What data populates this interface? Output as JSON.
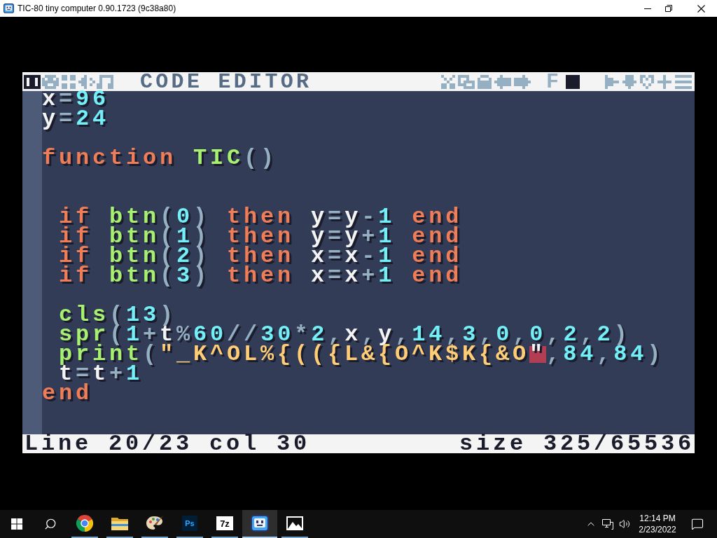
{
  "window": {
    "title": "TIC-80 tiny computer 0.90.1723 (9c38a80)"
  },
  "toolbar": {
    "tabs": [
      {
        "selected": true
      },
      {
        "selected": false
      },
      {
        "selected": false
      },
      {
        "selected": false
      },
      {
        "selected": false
      }
    ],
    "title": "CODE EDITOR",
    "toggles": [
      {
        "label": "F",
        "on": false
      },
      {
        "on": true
      }
    ]
  },
  "code": {
    "lines": [
      {
        "kind": "code",
        "indented": false,
        "tokens": [
          {
            "kind": "variable",
            "text": "x"
          },
          {
            "kind": "sign",
            "text": "="
          },
          {
            "kind": "number",
            "text": "96"
          }
        ]
      },
      {
        "kind": "code",
        "indented": false,
        "tokens": [
          {
            "kind": "variable",
            "text": "y"
          },
          {
            "kind": "sign",
            "text": "="
          },
          {
            "kind": "number",
            "text": "24"
          }
        ]
      },
      {
        "kind": "blank"
      },
      {
        "kind": "code",
        "indented": false,
        "tokens": [
          {
            "kind": "keyword",
            "text": "function "
          },
          {
            "kind": "api",
            "text": "TIC"
          },
          {
            "kind": "sign",
            "text": "()"
          }
        ]
      },
      {
        "kind": "blank"
      },
      {
        "kind": "blank"
      },
      {
        "kind": "code",
        "indented": true,
        "tokens": [
          {
            "kind": "keyword",
            "text": "if "
          },
          {
            "kind": "api",
            "text": "btn"
          },
          {
            "kind": "sign",
            "text": "("
          },
          {
            "kind": "number",
            "text": "0"
          },
          {
            "kind": "sign",
            "text": ") "
          },
          {
            "kind": "keyword",
            "text": "then "
          },
          {
            "kind": "variable",
            "text": "y"
          },
          {
            "kind": "sign",
            "text": "="
          },
          {
            "kind": "variable",
            "text": "y"
          },
          {
            "kind": "sign",
            "text": "-"
          },
          {
            "kind": "number",
            "text": "1 "
          },
          {
            "kind": "keyword",
            "text": "end"
          }
        ]
      },
      {
        "kind": "code",
        "indented": true,
        "tokens": [
          {
            "kind": "keyword",
            "text": "if "
          },
          {
            "kind": "api",
            "text": "btn"
          },
          {
            "kind": "sign",
            "text": "("
          },
          {
            "kind": "number",
            "text": "1"
          },
          {
            "kind": "sign",
            "text": ") "
          },
          {
            "kind": "keyword",
            "text": "then "
          },
          {
            "kind": "variable",
            "text": "y"
          },
          {
            "kind": "sign",
            "text": "="
          },
          {
            "kind": "variable",
            "text": "y"
          },
          {
            "kind": "sign",
            "text": "+"
          },
          {
            "kind": "number",
            "text": "1 "
          },
          {
            "kind": "keyword",
            "text": "end"
          }
        ]
      },
      {
        "kind": "code",
        "indented": true,
        "tokens": [
          {
            "kind": "keyword",
            "text": "if "
          },
          {
            "kind": "api",
            "text": "btn"
          },
          {
            "kind": "sign",
            "text": "("
          },
          {
            "kind": "number",
            "text": "2"
          },
          {
            "kind": "sign",
            "text": ") "
          },
          {
            "kind": "keyword",
            "text": "then "
          },
          {
            "kind": "variable",
            "text": "x"
          },
          {
            "kind": "sign",
            "text": "="
          },
          {
            "kind": "variable",
            "text": "x"
          },
          {
            "kind": "sign",
            "text": "-"
          },
          {
            "kind": "number",
            "text": "1 "
          },
          {
            "kind": "keyword",
            "text": "end"
          }
        ]
      },
      {
        "kind": "code",
        "indented": true,
        "tokens": [
          {
            "kind": "keyword",
            "text": "if "
          },
          {
            "kind": "api",
            "text": "btn"
          },
          {
            "kind": "sign",
            "text": "("
          },
          {
            "kind": "number",
            "text": "3"
          },
          {
            "kind": "sign",
            "text": ") "
          },
          {
            "kind": "keyword",
            "text": "then "
          },
          {
            "kind": "variable",
            "text": "x"
          },
          {
            "kind": "sign",
            "text": "="
          },
          {
            "kind": "variable",
            "text": "x"
          },
          {
            "kind": "sign",
            "text": "+"
          },
          {
            "kind": "number",
            "text": "1 "
          },
          {
            "kind": "keyword",
            "text": "end"
          }
        ]
      },
      {
        "kind": "blank"
      },
      {
        "kind": "code",
        "indented": true,
        "tokens": [
          {
            "kind": "api",
            "text": "cls"
          },
          {
            "kind": "sign",
            "text": "("
          },
          {
            "kind": "number",
            "text": "13"
          },
          {
            "kind": "sign",
            "text": ")"
          }
        ]
      },
      {
        "kind": "code",
        "indented": true,
        "tokens": [
          {
            "kind": "api",
            "text": "spr"
          },
          {
            "kind": "sign",
            "text": "("
          },
          {
            "kind": "number",
            "text": "1"
          },
          {
            "kind": "sign",
            "text": "+"
          },
          {
            "kind": "variable",
            "text": "t"
          },
          {
            "kind": "sign",
            "text": "%"
          },
          {
            "kind": "number",
            "text": "60"
          },
          {
            "kind": "sign",
            "text": "//"
          },
          {
            "kind": "number",
            "text": "30"
          },
          {
            "kind": "sign",
            "text": "*"
          },
          {
            "kind": "number",
            "text": "2"
          },
          {
            "kind": "sign",
            "text": ","
          },
          {
            "kind": "variable",
            "text": "x"
          },
          {
            "kind": "sign",
            "text": ","
          },
          {
            "kind": "variable",
            "text": "y"
          },
          {
            "kind": "sign",
            "text": ","
          },
          {
            "kind": "number",
            "text": "14"
          },
          {
            "kind": "sign",
            "text": ","
          },
          {
            "kind": "number",
            "text": "3"
          },
          {
            "kind": "sign",
            "text": ","
          },
          {
            "kind": "number",
            "text": "0"
          },
          {
            "kind": "sign",
            "text": ","
          },
          {
            "kind": "number",
            "text": "0"
          },
          {
            "kind": "sign",
            "text": ","
          },
          {
            "kind": "number",
            "text": "2"
          },
          {
            "kind": "sign",
            "text": ","
          },
          {
            "kind": "number",
            "text": "2"
          },
          {
            "kind": "sign",
            "text": ")"
          }
        ]
      },
      {
        "kind": "code",
        "indented": true,
        "tokens": [
          {
            "kind": "api",
            "text": "print"
          },
          {
            "kind": "sign",
            "text": "("
          },
          {
            "kind": "string",
            "text": "\"_K^OL%{(({L&{O^K$K{&O"
          },
          {
            "kind": "cursor",
            "text": "\""
          },
          {
            "kind": "sign",
            "text": ","
          },
          {
            "kind": "number",
            "text": "84"
          },
          {
            "kind": "sign",
            "text": ","
          },
          {
            "kind": "number",
            "text": "84"
          },
          {
            "kind": "sign",
            "text": ")"
          }
        ]
      },
      {
        "kind": "code",
        "indented": true,
        "tokens": [
          {
            "kind": "variable",
            "text": "t"
          },
          {
            "kind": "sign",
            "text": "="
          },
          {
            "kind": "variable",
            "text": "t"
          },
          {
            "kind": "sign",
            "text": "+"
          },
          {
            "kind": "number",
            "text": "1"
          }
        ]
      },
      {
        "kind": "code",
        "indented": false,
        "tokens": [
          {
            "kind": "keyword",
            "text": "end"
          }
        ]
      }
    ]
  },
  "status_bar": {
    "position": "Line 20/23 col 30",
    "size": "size 325/65536"
  },
  "taskbar": {
    "apps": [
      {
        "running": true,
        "selected": false
      },
      {
        "running": true,
        "selected": false
      },
      {
        "running": true,
        "selected": false
      },
      {
        "label": "Ps",
        "running": true,
        "selected": false
      },
      {
        "label": "7z",
        "running": true,
        "selected": false
      },
      {
        "running": true,
        "selected": true
      },
      {
        "running": true,
        "selected": false
      }
    ],
    "clock": {
      "time": "12:14 PM",
      "date": "2/23/2022"
    }
  }
}
